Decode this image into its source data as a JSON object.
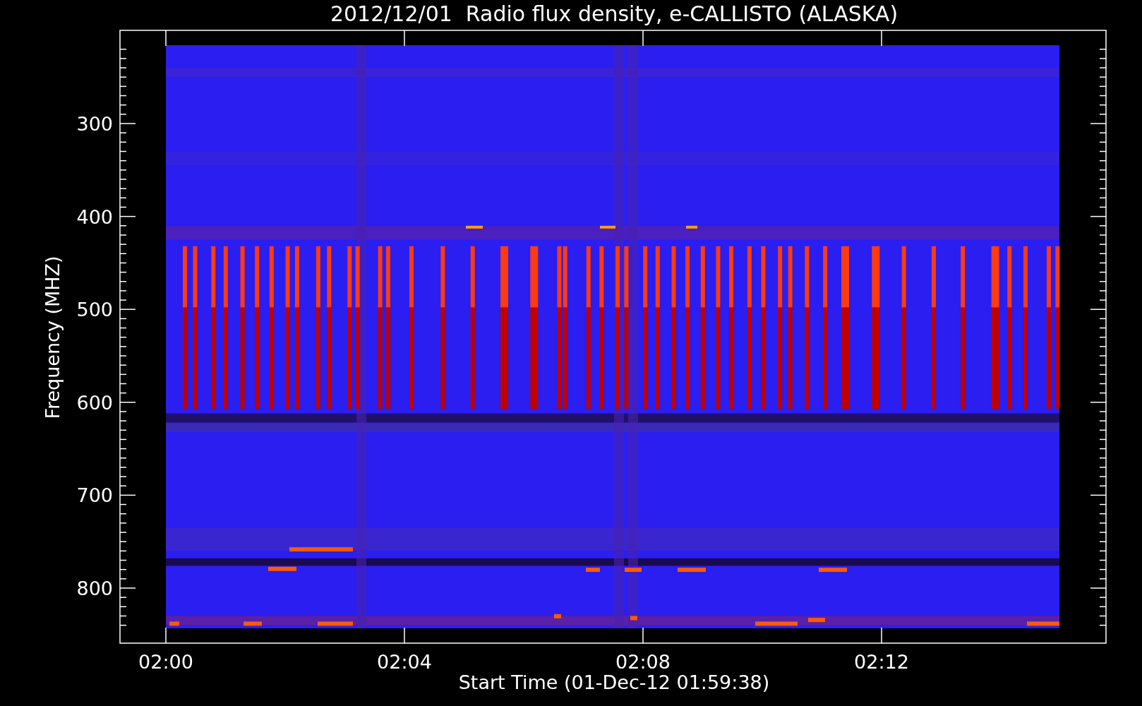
{
  "title": "2012/12/01  Radio flux density, e-CALLISTO (ALASKA)",
  "y_axis": {
    "label": "Frequency (MHZ)",
    "ticks": [
      "300",
      "400",
      "500",
      "600",
      "700",
      "800"
    ]
  },
  "x_axis": {
    "label": "Start Time (01-Dec-12 01:59:38)",
    "ticks": [
      "02:00",
      "02:04",
      "02:08",
      "02:12"
    ]
  }
}
